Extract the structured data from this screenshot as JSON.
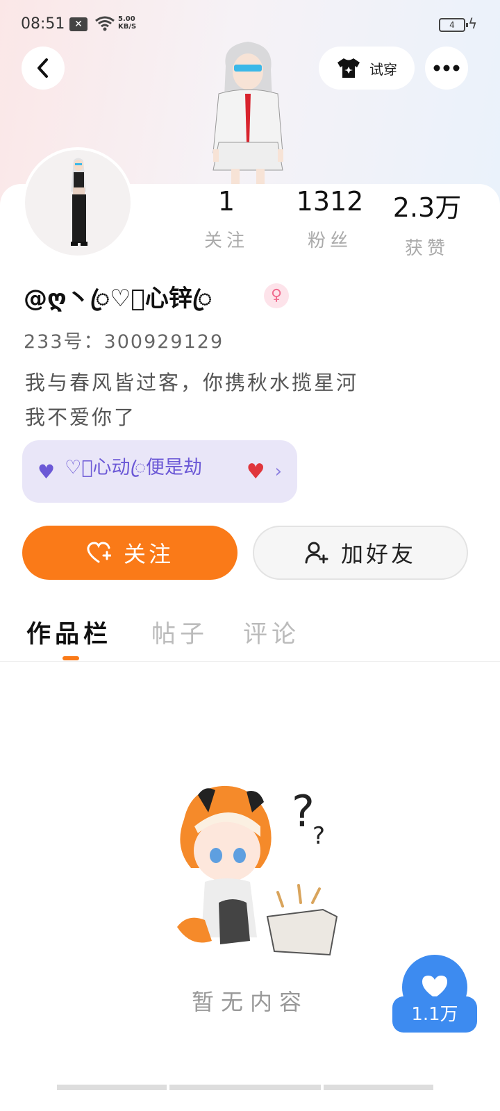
{
  "status_bar": {
    "time": "08:51",
    "network_speed_value": "5.00",
    "network_speed_unit": "KB/S",
    "battery_level": "4"
  },
  "header": {
    "try_on_label": "试穿"
  },
  "stats": {
    "following_value": "1",
    "following_label": "关注",
    "followers_value": "1312",
    "followers_label": "粉丝",
    "likes_value": "2.3万",
    "likes_label": "获赞"
  },
  "profile": {
    "username": "@ღ丶ꦿ♡ꦿ心锌ꦿ",
    "uid": "233号：300929129",
    "bio_line1": "我与春风皆过客，你携秋水揽星河",
    "bio_line2": "我不爱你了",
    "medal_text": "♡ꦿ心动ꦿ便是劫"
  },
  "actions": {
    "follow_label": "关注",
    "add_friend_label": "加好友"
  },
  "tabs": [
    {
      "label": "作品栏"
    },
    {
      "label": "帖子"
    },
    {
      "label": "评论"
    }
  ],
  "empty_state": {
    "text": "暂无内容"
  },
  "like_fab": {
    "count": "1.1万"
  },
  "colors": {
    "accent_orange": "#fa7a18",
    "like_blue": "#3d8bf0",
    "medal_purple": "#6b58d6",
    "female_pink": "#f06a8e"
  },
  "icons": [
    "back-icon",
    "shirt-icon",
    "more-icon",
    "heart-plus-icon",
    "user-plus-icon",
    "heart-icon",
    "chevron-right-icon",
    "female-icon"
  ]
}
